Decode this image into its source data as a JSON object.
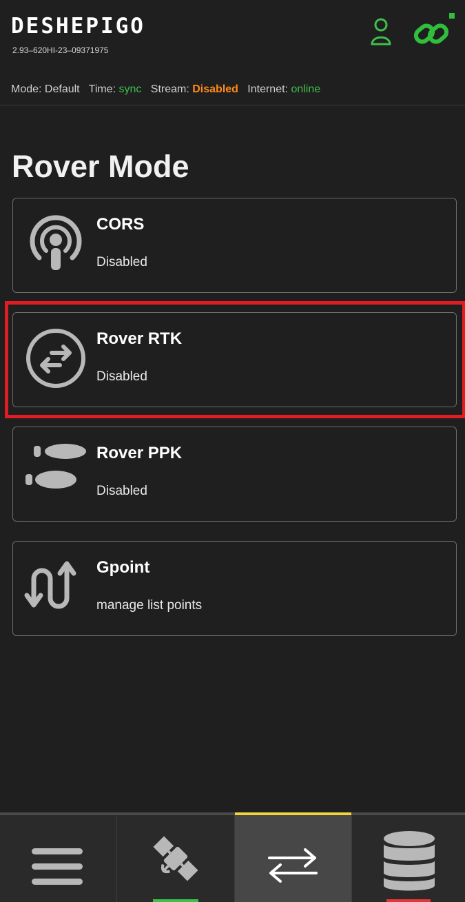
{
  "header": {
    "brand": "DESHEPIGO",
    "serial": "2.93–620HI-23–09371975",
    "status": {
      "mode_label": "Mode:",
      "mode_value": "Default",
      "time_label": "Time:",
      "time_value": "sync",
      "stream_label": "Stream:",
      "stream_value": "Disabled",
      "internet_label": "Internet:",
      "internet_value": "online"
    },
    "icons": [
      "user-icon",
      "link-icon"
    ]
  },
  "page": {
    "title": "Rover Mode"
  },
  "modes": [
    {
      "title": "CORS",
      "subtitle": "Disabled",
      "icon": "broadcast-icon"
    },
    {
      "title": "Rover RTK",
      "subtitle": "Disabled",
      "icon": "exchange-arrows-icon",
      "highlighted": true
    },
    {
      "title": "Rover PPK",
      "subtitle": "Disabled",
      "icon": "footprints-icon"
    },
    {
      "title": "Gpoint",
      "subtitle": "manage list points",
      "icon": "route-arrows-icon"
    }
  ],
  "bottom_nav": {
    "tabs": [
      {
        "icon": "menu-icon"
      },
      {
        "icon": "satellite-icon"
      },
      {
        "icon": "swap-arrows-icon",
        "active": true
      },
      {
        "icon": "database-icon"
      }
    ]
  },
  "colors": {
    "status_green": "#3fbf4c",
    "status_orange": "#ff8a1a",
    "link_green": "#2fbf3c",
    "active_tab_accent": "#f0d43a",
    "satellite_indicator": "#3fbf4c",
    "database_indicator": "#e2373a",
    "highlight_red": "#e21c23"
  }
}
